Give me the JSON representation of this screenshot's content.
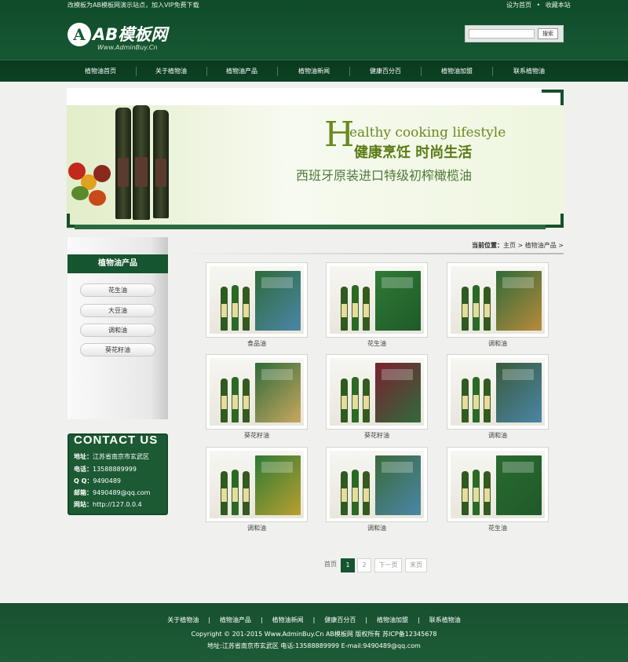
{
  "topbar": {
    "notice": "改模板为AB模板网演示站点，加入VIP免费下载",
    "set_home": "设为首页",
    "dot": "•",
    "favorite": "收藏本站"
  },
  "logo": {
    "mark": "A",
    "name": "AB模板网",
    "sub": "Www.AdminBuy.Cn"
  },
  "search": {
    "placeholder": "",
    "button": "搜索"
  },
  "nav": {
    "items": [
      "植物油首页",
      "关于植物油",
      "植物油产品",
      "植物油新闻",
      "健康百分百",
      "植物油加盟",
      "联系植物油"
    ]
  },
  "banner": {
    "big_letter": "H",
    "english": "ealthy cooking lifestyle",
    "chinese_1": "健康烹饪 时尚生活",
    "chinese_2": "西班牙原装进口特级初榨橄榄油"
  },
  "sidebar": {
    "title": "植物油产品",
    "categories": [
      "花生油",
      "大豆油",
      "调和油",
      "葵花籽油"
    ]
  },
  "contact": {
    "heading": "CONTACT US",
    "lines": [
      {
        "label": "地址：",
        "value": "江苏省南京市玄武区"
      },
      {
        "label": "电话：",
        "value": "13588889999"
      },
      {
        "label": "Q Q：",
        "value": "9490489"
      },
      {
        "label": "邮箱：",
        "value": "9490489@qq.com"
      },
      {
        "label": "网站：",
        "value": "http://127.0.0.4"
      }
    ]
  },
  "breadcrumb": {
    "label": "当前位置：",
    "home": "主页",
    "sep": " > ",
    "current": "植物油产品",
    "tail": " >"
  },
  "products": [
    {
      "caption": "食品油"
    },
    {
      "caption": "花生油"
    },
    {
      "caption": "调和油"
    },
    {
      "caption": "葵花籽油"
    },
    {
      "caption": "葵花籽油"
    },
    {
      "caption": "调和油"
    },
    {
      "caption": "调和油"
    },
    {
      "caption": "调和油"
    },
    {
      "caption": "花生油"
    }
  ],
  "pager": {
    "first": "首页",
    "page1": "1",
    "page2": "2",
    "next": "下一页",
    "last": "末页"
  },
  "footer": {
    "links": [
      "关于植物油",
      "植物油产品",
      "植物油新闻",
      "健康百分百",
      "植物油加盟",
      "联系植物油"
    ],
    "sep": "|",
    "copyright": "Copyright © 201-2015 Www.AdminBuy.Cn AB模板网 版权所有   苏ICP备12345678",
    "address": "地址:江苏省南京市玄武区    电话:13588889999    E-mail:9490489@qq.com"
  },
  "colors": {
    "brand_green": "#15552f",
    "background": "#f0f0ef"
  }
}
